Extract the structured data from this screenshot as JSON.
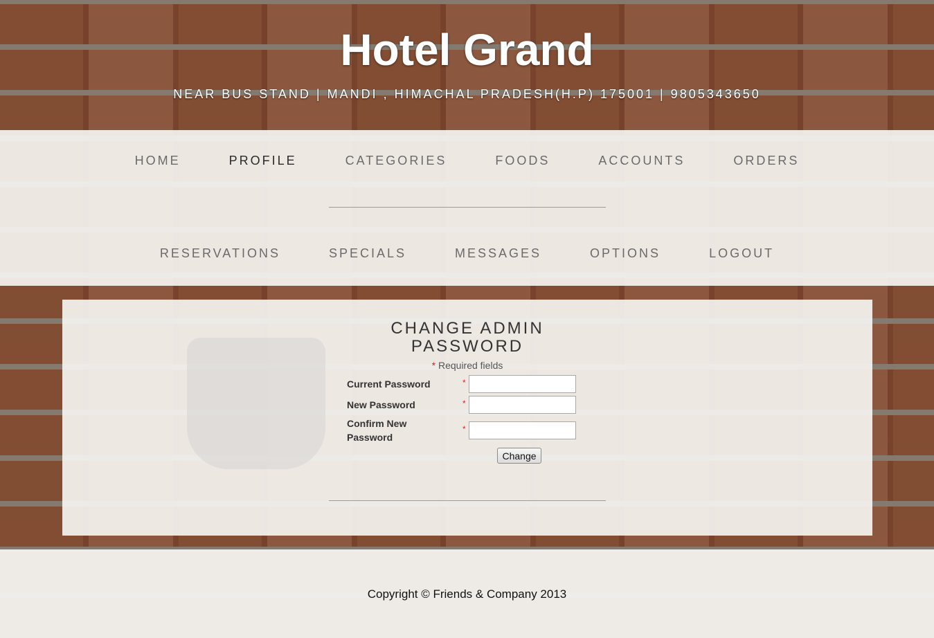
{
  "header": {
    "title": "Hotel Grand",
    "subtitle": "NEAR BUS STAND | MANDI , HIMACHAL PRADESH(H.P) 175001 | 9805343650"
  },
  "nav": {
    "row1": [
      "HOME",
      "PROFILE",
      "CATEGORIES",
      "FOODS",
      "ACCOUNTS",
      "ORDERS"
    ],
    "row2": [
      "RESERVATIONS",
      "SPECIALS",
      "MESSAGES",
      "OPTIONS",
      "LOGOUT"
    ],
    "active": "PROFILE"
  },
  "form": {
    "heading_line1": "CHANGE ADMIN",
    "heading_line2": "PASSWORD",
    "required_star": "*",
    "required_note": "Required fields",
    "fields": [
      {
        "label": "Current Password",
        "value": ""
      },
      {
        "label": "New Password",
        "value": ""
      },
      {
        "label": "Confirm New Password",
        "value": ""
      }
    ],
    "submit_label": "Change"
  },
  "footer": {
    "copyright": "Copyright © Friends & Company 2013"
  },
  "colors": {
    "panel_bg": "#f5f3f0",
    "nav_text": "#6a6a6a",
    "nav_active": "#2a2a2a",
    "required_star": "#dd2222"
  }
}
